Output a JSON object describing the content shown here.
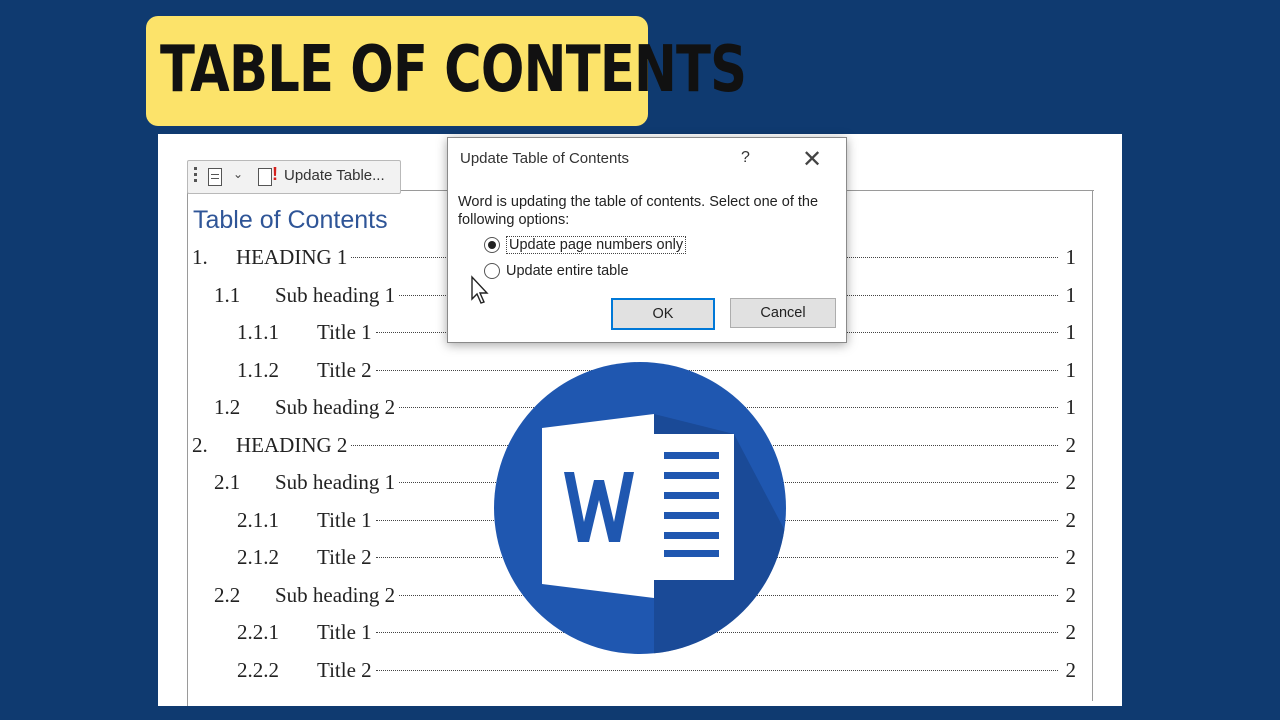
{
  "banner": {
    "text": "TABLE OF CONTENTS"
  },
  "content_control": {
    "label": "Update Table..."
  },
  "toc": {
    "title": "Table of Contents",
    "entries": [
      {
        "num": "1.",
        "text": "HEADING 1",
        "page": "1",
        "level": 1
      },
      {
        "num": "1.1",
        "text": "Sub heading 1",
        "page": "1",
        "level": 2
      },
      {
        "num": "1.1.1",
        "text": "Title 1",
        "page": "1",
        "level": 3
      },
      {
        "num": "1.1.2",
        "text": "Title 2",
        "page": "1",
        "level": 3
      },
      {
        "num": "1.2",
        "text": "Sub heading 2",
        "page": "1",
        "level": 2
      },
      {
        "num": "2.",
        "text": "HEADING 2",
        "page": "2",
        "level": 1
      },
      {
        "num": "2.1",
        "text": "Sub heading 1",
        "page": "2",
        "level": 2
      },
      {
        "num": "2.1.1",
        "text": "Title 1",
        "page": "2",
        "level": 3
      },
      {
        "num": "2.1.2",
        "text": "Title 2",
        "page": "2",
        "level": 3
      },
      {
        "num": "2.2",
        "text": "Sub heading 2",
        "page": "2",
        "level": 2
      },
      {
        "num": "2.2.1",
        "text": "Title 1",
        "page": "2",
        "level": 3
      },
      {
        "num": "2.2.2",
        "text": "Title 2",
        "page": "2",
        "level": 3
      }
    ]
  },
  "dialog": {
    "title": "Update Table of Contents",
    "help": "?",
    "message": "Word is updating the table of contents.  Select one of the following options:",
    "option1": "Update page numbers only",
    "option2": "Update entire table",
    "ok": "OK",
    "cancel": "Cancel"
  },
  "colors": {
    "background": "#0f3a70",
    "banner": "#fce36a",
    "toc_title": "#2f5597",
    "word_blue": "#1f57b0"
  },
  "icons": [
    "word-logo-icon",
    "mouse-cursor-icon",
    "close-icon",
    "help-icon"
  ]
}
